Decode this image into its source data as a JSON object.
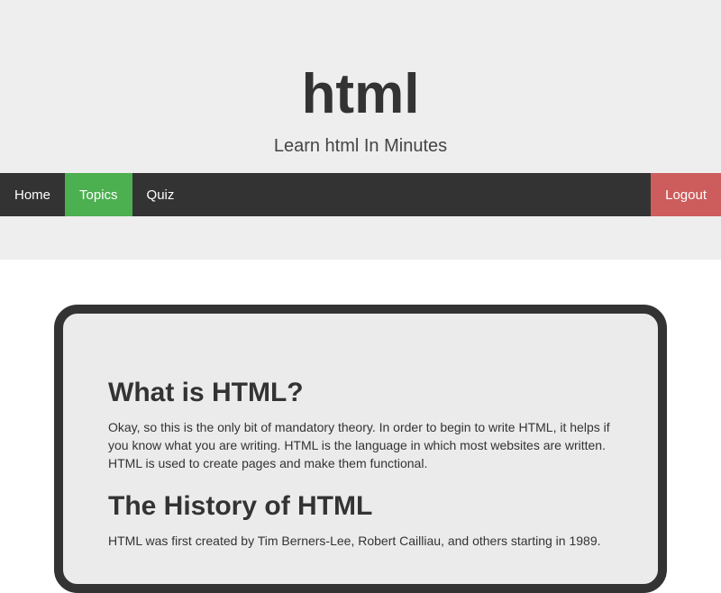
{
  "header": {
    "title": "html",
    "subtitle": "Learn html In Minutes"
  },
  "nav": {
    "items": [
      {
        "label": "Home",
        "active": false
      },
      {
        "label": "Topics",
        "active": true
      },
      {
        "label": "Quiz",
        "active": false
      }
    ],
    "logout_label": "Logout"
  },
  "colors": {
    "header_bg": "#eeeeee",
    "nav_bg": "#333333",
    "active_tab": "#4caf50",
    "logout": "#cd5c5c",
    "card_border": "#333333",
    "card_bg": "#ebebeb"
  },
  "content": {
    "sections": [
      {
        "heading": "What is HTML?",
        "text": "Okay, so this is the only bit of mandatory theory. In order to begin to write HTML, it helps if you know what you are writing. HTML is the language in which most websites are written. HTML is used to create pages and make them functional."
      },
      {
        "heading": "The History of HTML",
        "text": "HTML was first created by Tim Berners-Lee, Robert Cailliau, and others starting in 1989."
      }
    ]
  }
}
